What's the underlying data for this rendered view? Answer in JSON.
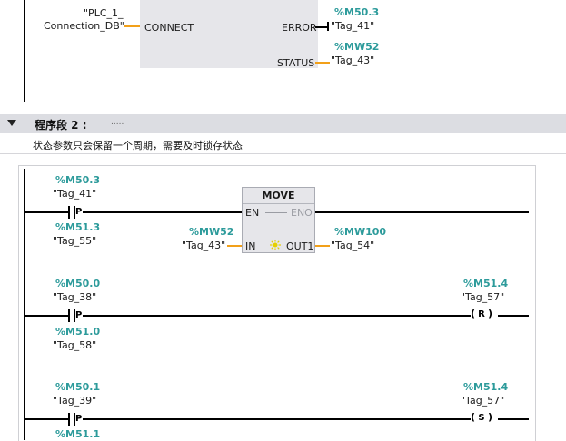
{
  "network1": {
    "plc_tag_line1": "\"PLC_1_",
    "plc_tag_line2": "Connection_DB\"",
    "connect_pin": "CONNECT",
    "error_pin": "ERROR",
    "status_pin": "STATUS",
    "error_addr": "%M50.3",
    "error_tag": "\"Tag_41\"",
    "status_addr": "%MW52",
    "status_tag": "\"Tag_43\""
  },
  "segment2": {
    "title": "程序段 2 :",
    "dots": ".....",
    "comment": "状态参数只会保留一个周期，需要及时锁存状态"
  },
  "rung1": {
    "contact_addr": "%M50.3",
    "contact_tag": "\"Tag_41\"",
    "contact_label": "P",
    "edge_addr": "%M51.3",
    "edge_tag": "\"Tag_55\"",
    "move": {
      "title": "MOVE",
      "en": "EN",
      "eno": "ENO",
      "in": "IN",
      "out": "OUT1",
      "in_addr": "%MW52",
      "in_tag": "\"Tag_43\"",
      "out_addr": "%MW100",
      "out_tag": "\"Tag_54\""
    }
  },
  "rung2": {
    "contact_addr": "%M50.0",
    "contact_tag": "\"Tag_38\"",
    "contact_label": "P",
    "edge_addr": "%M51.0",
    "edge_tag": "\"Tag_58\"",
    "coil_addr": "%M51.4",
    "coil_tag": "\"Tag_57\"",
    "coil_label": "R"
  },
  "rung3": {
    "contact_addr": "%M50.1",
    "contact_tag": "\"Tag_39\"",
    "contact_label": "P",
    "edge_addr": "%M51.1",
    "coil_addr": "%M51.4",
    "coil_tag": "\"Tag_57\"",
    "coil_label": "S"
  },
  "colors": {
    "address": "#2d9b9b",
    "connection": "#f2a019",
    "block": "#e6e6ea",
    "header": "#dcdde2"
  }
}
